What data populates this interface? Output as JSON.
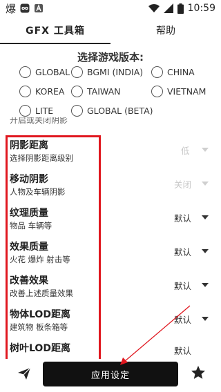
{
  "status_bar": {
    "app_char": "爆",
    "time": "10:59",
    "icons": [
      "infinity-icon",
      "notification-a-icon",
      "wifi-icon",
      "signal-icon",
      "battery-icon"
    ]
  },
  "tabs": [
    {
      "label": "GFX 工具箱",
      "active": true
    },
    {
      "label": "帮助",
      "active": false
    }
  ],
  "version_select": {
    "title": "选择游戏版本:",
    "options": [
      "GLOBAL",
      "BGMI (INDIA)",
      "CHINA",
      "KOREA",
      "TAIWAN",
      "VIETNAM",
      "LITE",
      "GLOBAL (BETA)"
    ]
  },
  "hidden_row_text": "开启或关闭阴影",
  "settings": [
    {
      "title": "阴影距离",
      "desc": "选择阴影距离级别",
      "value": "低",
      "disabled": true
    },
    {
      "title": "移动阴影",
      "desc": "人物及车辆阴影",
      "value": "关闭",
      "disabled": true
    },
    {
      "title": "纹理质量",
      "desc": "物品 车辆等",
      "value": "默认",
      "disabled": false
    },
    {
      "title": "效果质量",
      "desc": "火花 爆炸 射击等",
      "value": "默认",
      "disabled": false
    },
    {
      "title": "改善效果",
      "desc": "改善上述质量效果",
      "value": "默认",
      "disabled": false
    },
    {
      "title": "物体LOD距离",
      "desc": "建筑物 板条箱等",
      "value": "默认",
      "disabled": false
    },
    {
      "title": "树叶LOD距离",
      "desc": "",
      "value": "默认",
      "disabled": false
    }
  ],
  "bottom_bar": {
    "apply_label": "应用设定",
    "left_icon": "send-icon",
    "right_icon": "star-icon"
  },
  "colors": {
    "highlight": "#e0171f",
    "button_bg": "#111111",
    "disabled_text": "#c8c8c8"
  }
}
